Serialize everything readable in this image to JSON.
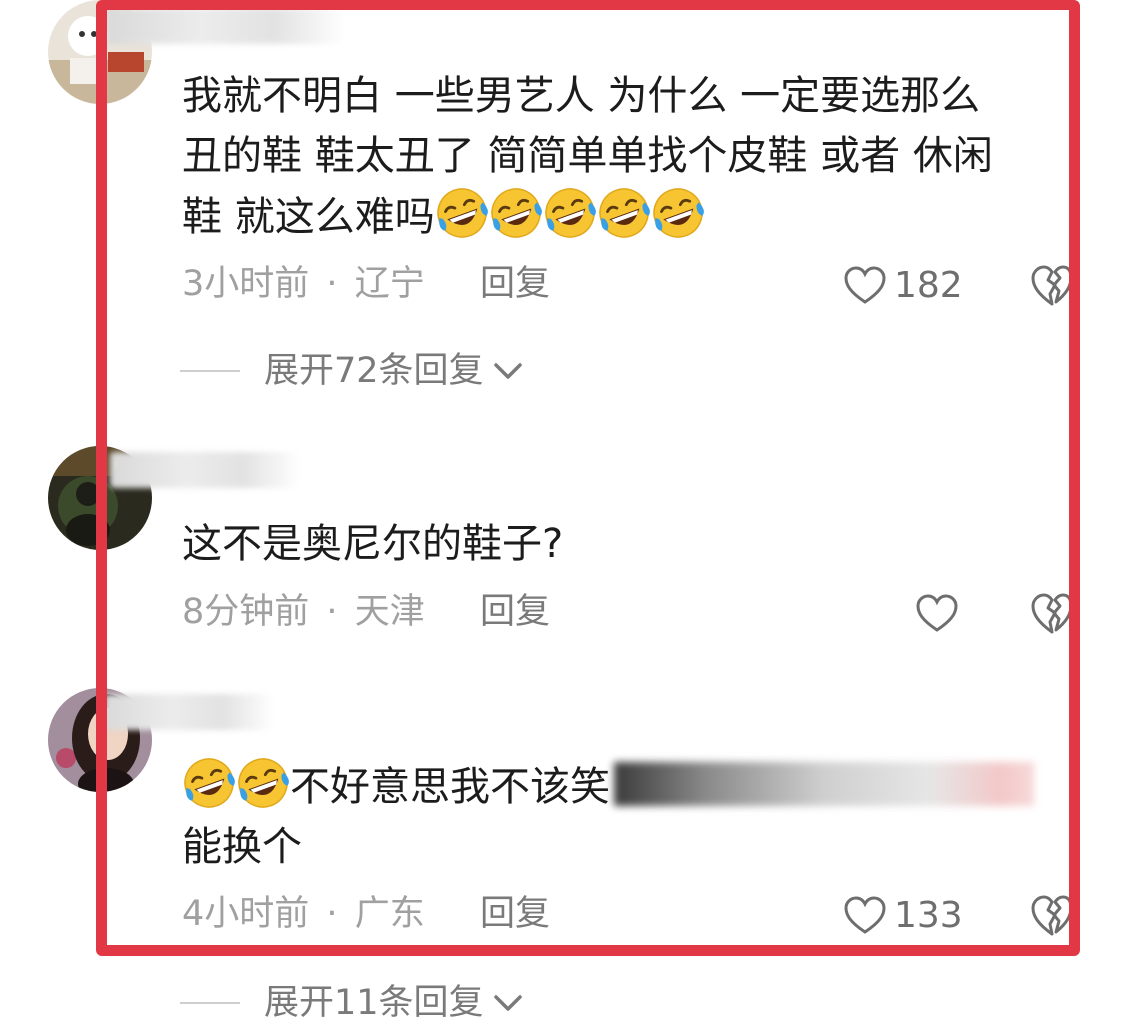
{
  "comments": [
    {
      "text_lines": [
        "我就不明白 一些男艺人 为什么 一定要选那么",
        "丑的鞋 鞋太丑了 简简单单找个皮鞋 或者 休闲",
        "鞋 就这么难吗"
      ],
      "emoji_count": 5,
      "emoji_icon": "rofl-emoji",
      "time": "3小时前",
      "location": "辽宁",
      "reply_label": "回复",
      "likes": "182",
      "expand_label": "展开72条回复"
    },
    {
      "text": "这不是奥尼尔的鞋子?",
      "time": "8分钟前",
      "location": "天津",
      "reply_label": "回复",
      "likes": ""
    },
    {
      "text_a": "不好意思我不该笑",
      "text_b": "能换个",
      "emoji_count": 2,
      "emoji_icon": "rofl-emoji",
      "time": "4小时前",
      "location": "广东",
      "reply_label": "回复",
      "likes": "133",
      "expand_label": "展开11条回复"
    }
  ],
  "meta_separator": "·",
  "colors": {
    "highlight": "#e23744",
    "meta_text": "#a0a0a0",
    "body_text": "#1c1c1c"
  }
}
